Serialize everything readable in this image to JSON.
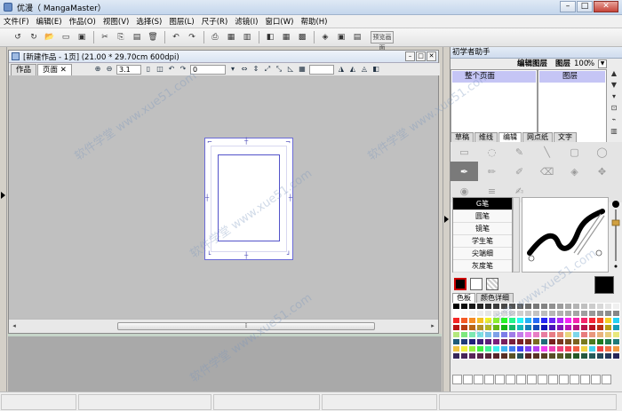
{
  "window": {
    "title": "优漫（ MangaMaster）",
    "controls": [
      "–",
      "□",
      "✕"
    ]
  },
  "menu": [
    "文件(F)",
    "编辑(E)",
    "作品(O)",
    "视图(V)",
    "选择(S)",
    "图层(L)",
    "尺子(R)",
    "滤镜(I)",
    "窗口(W)",
    "帮助(H)"
  ],
  "toolbar": {
    "wide_button_label": "预览画面"
  },
  "document": {
    "title": "[新建作品 - 1页] (21.00 * 29.70cm 600dpi)",
    "tabs": [
      {
        "label": "作品"
      },
      {
        "label": "页面 ✕"
      }
    ],
    "zoom": "3.1",
    "rotation": "0"
  },
  "right_panel": {
    "assistant_title": "初学者助手",
    "edit_layer_label": "编辑图层",
    "layer_name": "图层",
    "zoom_value": "100",
    "zoom_unit": "%",
    "pages_item": "整个页面",
    "layers_item": "图层",
    "tool_tabs": [
      "草稿",
      "维线",
      "编辑",
      "网点纸",
      "文字"
    ],
    "active_tool_tab_index": 2,
    "pens": [
      "G笔",
      "圆笔",
      "镜笔",
      "学生笔",
      "尖端细",
      "灰度笔"
    ],
    "active_pen_index": 0,
    "palette_tabs": [
      "色板",
      "颜色详细"
    ]
  },
  "watermark_text": "软件学堂 www.xue51.com",
  "colors": {
    "accent": "#3a3ab0",
    "selection": "#c5c5f5",
    "canvas_bg": "#c0c0c0"
  }
}
